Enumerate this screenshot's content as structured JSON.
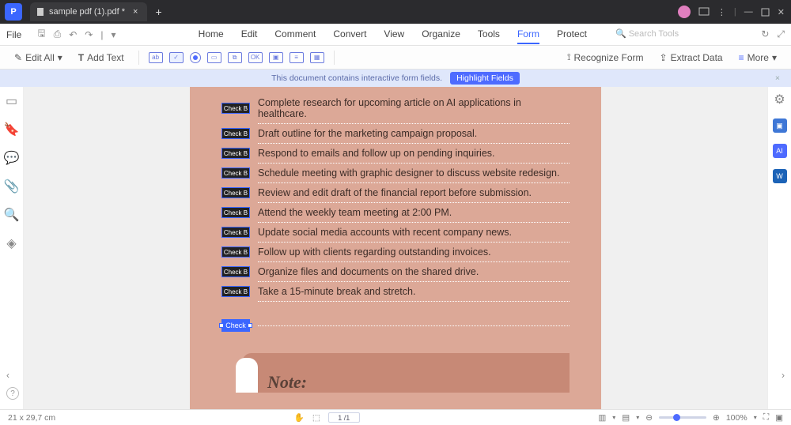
{
  "titlebar": {
    "tab_name": "sample pdf (1).pdf *"
  },
  "menu": {
    "file": "File",
    "items": [
      "Home",
      "Edit",
      "Comment",
      "Convert",
      "View",
      "Organize",
      "Tools",
      "Form",
      "Protect"
    ],
    "search_placeholder": "Search Tools"
  },
  "toolbar": {
    "edit_all": "Edit All",
    "add_text": "Add Text",
    "recognize": "Recognize Form",
    "extract": "Extract Data",
    "more": "More"
  },
  "banner": {
    "msg": "This document contains interactive form fields.",
    "pill": "Highlight Fields"
  },
  "tasks": [
    "Complete research for upcoming article on AI applications in healthcare.",
    "Draft outline for the marketing campaign proposal.",
    "Respond to emails and follow up on pending inquiries.",
    "Schedule meeting with graphic designer to discuss website redesign.",
    "Review and edit draft of the financial report before submission.",
    "Attend the weekly team meeting at 2:00 PM.",
    "Update social media accounts with recent company news.",
    "Follow up with clients regarding outstanding invoices.",
    "Organize files and documents on the shared drive.",
    "Take a 15-minute break and stretch."
  ],
  "check_label": "Check B",
  "check_sel": "Check",
  "note": "Note:",
  "status": {
    "page_dims": "21 x 29,7 cm",
    "page_num": "1 /1",
    "zoom": "100%"
  }
}
